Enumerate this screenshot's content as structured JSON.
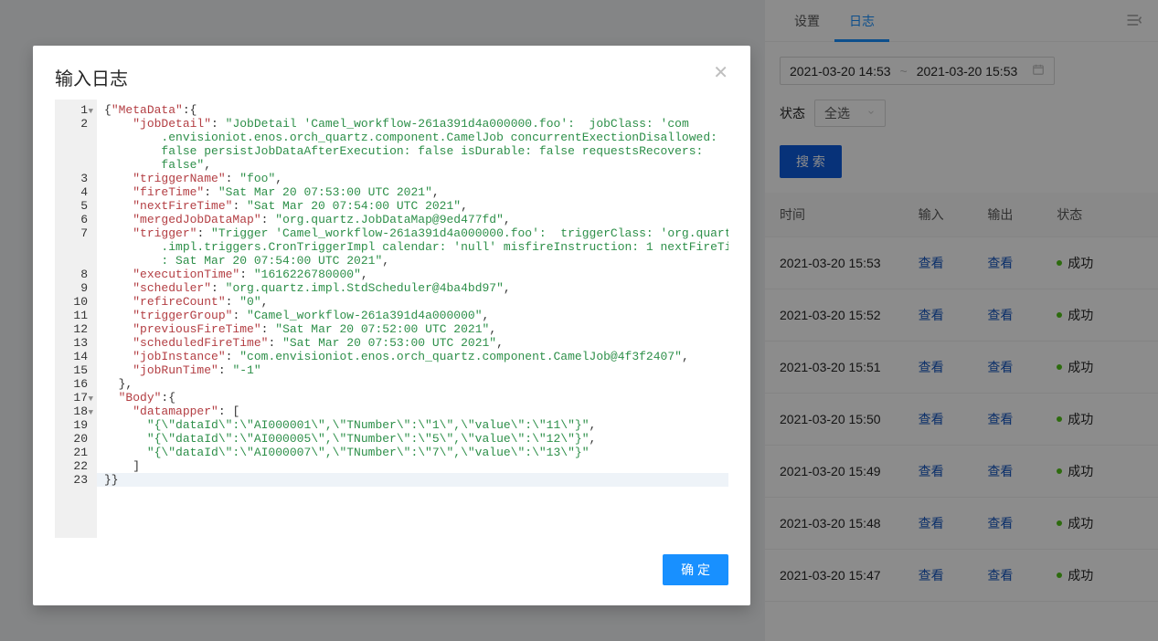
{
  "tabs": {
    "settings": "设置",
    "logs": "日志"
  },
  "date_range": {
    "from": "2021-03-20 14:53",
    "sep": "~",
    "to": "2021-03-20 15:53"
  },
  "status_filter": {
    "label": "状态",
    "value": "全选"
  },
  "search_btn": "搜 索",
  "table": {
    "headers": {
      "time": "时间",
      "input": "输入",
      "output": "输出",
      "status": "状态"
    },
    "view": "查看",
    "success": "成功",
    "rows": [
      {
        "ts": "2021-03-20 15:53"
      },
      {
        "ts": "2021-03-20 15:52"
      },
      {
        "ts": "2021-03-20 15:51"
      },
      {
        "ts": "2021-03-20 15:50"
      },
      {
        "ts": "2021-03-20 15:49"
      },
      {
        "ts": "2021-03-20 15:48"
      },
      {
        "ts": "2021-03-20 15:47"
      }
    ]
  },
  "modal": {
    "title": "输入日志",
    "ok": "确 定",
    "code_lines": [
      "1",
      "2",
      "3",
      "4",
      "5",
      "6",
      "7",
      "8",
      "9",
      "10",
      "11",
      "12",
      "13",
      "14",
      "15",
      "16",
      "17",
      "18",
      "19",
      "20",
      "21",
      "22",
      "23"
    ],
    "json_content": {
      "MetaData": {
        "jobDetail": "JobDetail 'Camel_workflow-261a391d4a000000.foo':  jobClass: 'com.envisioniot.enos.orch_quartz.component.CamelJob concurrentExectionDisallowed: false persistJobDataAfterExecution: false isDurable: false requestsRecovers: false",
        "triggerName": "foo",
        "fireTime": "Sat Mar 20 07:53:00 UTC 2021",
        "nextFireTime": "Sat Mar 20 07:54:00 UTC 2021",
        "mergedJobDataMap": "org.quartz.JobDataMap@9ed477fd",
        "trigger": "Trigger 'Camel_workflow-261a391d4a000000.foo':  triggerClass: 'org.quartz.impl.triggers.CronTriggerImpl calendar: 'null' misfireInstruction: 1 nextFireTime: Sat Mar 20 07:54:00 UTC 2021",
        "executionTime": "1616226780000",
        "scheduler": "org.quartz.impl.StdScheduler@4ba4bd97",
        "refireCount": "0",
        "triggerGroup": "Camel_workflow-261a391d4a000000",
        "previousFireTime": "Sat Mar 20 07:52:00 UTC 2021",
        "scheduledFireTime": "Sat Mar 20 07:53:00 UTC 2021",
        "jobInstance": "com.envisioniot.enos.orch_quartz.component.CamelJob@4f3f2407",
        "jobRunTime": "-1"
      },
      "Body": {
        "datamapper": [
          "{\\\"dataId\\\":\\\"AI000001\\\",\\\"TNumber\\\":\\\"1\\\",\\\"value\\\":\\\"11\\\"}",
          "{\\\"dataId\\\":\\\"AI000005\\\",\\\"TNumber\\\":\\\"5\\\",\\\"value\\\":\\\"12\\\"}",
          "{\\\"dataId\\\":\\\"AI000007\\\",\\\"TNumber\\\":\\\"7\\\",\\\"value\\\":\\\"13\\\"}"
        ]
      }
    }
  }
}
